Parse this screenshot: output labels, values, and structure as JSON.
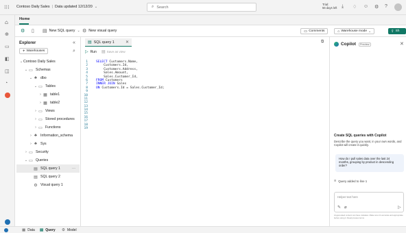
{
  "topbar": {
    "title": "Contoso Daily Sales",
    "updated": "Data updated 12/12/20",
    "search_placeholder": "Search",
    "trial_line1": "Trial:",
    "trial_line2": "56 days left"
  },
  "home_tab": "Home",
  "ribbon": {
    "new_sql_query": "New SQL query",
    "new_visual_query": "New visual query",
    "comments": "Comments",
    "warehouse_mode": "Warehouse mode",
    "share": "Sh"
  },
  "explorer": {
    "title": "Explorer",
    "warehouses_btn": "Warehouses",
    "items": [
      {
        "label": "Contoso Daily Sales",
        "chev": "⌄",
        "icon": "",
        "indent": 0
      },
      {
        "label": "Schemas",
        "chev": "⌄",
        "icon": "▭",
        "indent": 1
      },
      {
        "label": "dbo",
        "chev": "⌄",
        "icon": "♣",
        "indent": 2
      },
      {
        "label": "Tables",
        "chev": "⌄",
        "icon": "▭",
        "indent": 3
      },
      {
        "label": "table1",
        "chev": "›",
        "icon": "▦",
        "indent": 4
      },
      {
        "label": "table2",
        "chev": "›",
        "icon": "▦",
        "indent": 4
      },
      {
        "label": "Views",
        "chev": "›",
        "icon": "▭",
        "indent": 3
      },
      {
        "label": "Stored procedures",
        "chev": "›",
        "icon": "▭",
        "indent": 3
      },
      {
        "label": "Functions",
        "chev": "›",
        "icon": "▭",
        "indent": 3
      },
      {
        "label": "Information_schema",
        "chev": "›",
        "icon": "♣",
        "indent": 2
      },
      {
        "label": "Sys",
        "chev": "›",
        "icon": "♣",
        "indent": 2
      },
      {
        "label": "Security",
        "chev": "›",
        "icon": "▭",
        "indent": 1
      },
      {
        "label": "Queries",
        "chev": "⌄",
        "icon": "▭",
        "indent": 1
      },
      {
        "label": "SQL query 1",
        "chev": "",
        "icon": "▤",
        "indent": 2,
        "selected": true,
        "more": "···"
      },
      {
        "label": "SQL query 2",
        "chev": "",
        "icon": "▤",
        "indent": 2
      },
      {
        "label": "Visual query 1",
        "chev": "",
        "icon": "⚙",
        "indent": 2
      }
    ]
  },
  "editor": {
    "tab_label": "SQL query 1",
    "run": "Run",
    "save_as_view": "Save as view",
    "lines": [
      {
        "n": "1",
        "kw": "SELECT",
        "rest": " Customers.Name,"
      },
      {
        "n": "2",
        "kw": "",
        "rest": "    Customers.Id,"
      },
      {
        "n": "3",
        "kw": "",
        "rest": "    Customers.Address,"
      },
      {
        "n": "4",
        "kw": "",
        "rest": "    Sales.Amount,"
      },
      {
        "n": "5",
        "kw": "",
        "rest": "    Sales.Customer_Id,"
      },
      {
        "n": "6",
        "kw": "FROM",
        "rest": " Customers"
      },
      {
        "n": "7",
        "kw": "INNER JOIN",
        "rest": " Sales"
      },
      {
        "n": "8",
        "kw": "ON",
        "rest": " Customers.Id = Sales.Customer_Id;"
      },
      {
        "n": "9",
        "kw": "",
        "rest": ""
      },
      {
        "n": "10",
        "kw": "",
        "rest": ""
      },
      {
        "n": "11",
        "kw": "",
        "rest": ""
      },
      {
        "n": "12",
        "kw": "",
        "rest": ""
      },
      {
        "n": "13",
        "kw": "",
        "rest": ""
      },
      {
        "n": "14",
        "kw": "",
        "rest": ""
      },
      {
        "n": "15",
        "kw": "",
        "rest": ""
      },
      {
        "n": "16",
        "kw": "",
        "rest": ""
      },
      {
        "n": "17",
        "kw": "",
        "rest": ""
      },
      {
        "n": "18",
        "kw": "",
        "rest": ""
      },
      {
        "n": "19",
        "kw": "",
        "rest": ""
      }
    ]
  },
  "copilot": {
    "title": "Copilot",
    "badge": "Preview",
    "heading": "Create SQL queries with Copilot",
    "description": "Describe the query you want, in your own words, and Copilot will create it quickly.",
    "user_message": "How do I pull sales data over the last 24 months, grouping by product in descending order?",
    "status": "Query added to line 1",
    "input_placeholder": "Helper text here",
    "disclaimer": "AI-generated content can have mistakes. Make sure it's accurate and appropriate before using it. Read preview terms"
  },
  "statusbar": {
    "data": "Data",
    "query": "Query",
    "model": "Model"
  },
  "colors": {
    "accent": "#117865",
    "brand_green": "#0f6c5d",
    "selected_bg": "#ebebeb",
    "keyword": "#0000ff",
    "line_number": "#237893"
  }
}
